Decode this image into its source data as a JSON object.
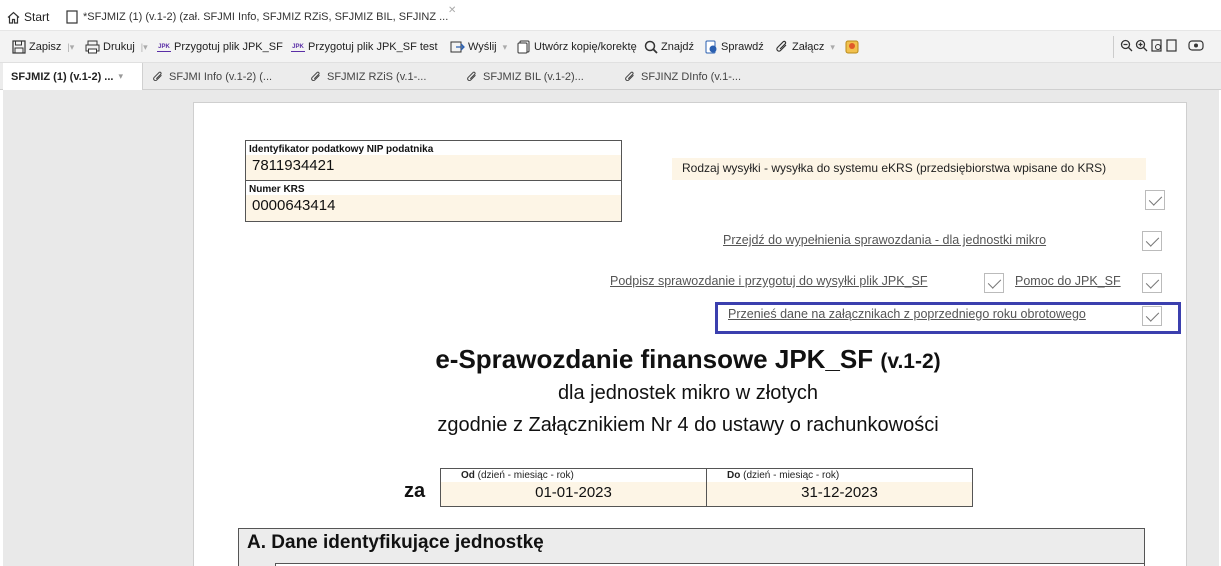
{
  "tabs": {
    "start": "Start",
    "document": "*SFJMIZ (1) (v.1-2) (zał. SFJMI Info, SFJMIZ RZiS, SFJMIZ BIL, SFJINZ ..."
  },
  "toolbar": {
    "save": "Zapisz",
    "print": "Drukuj",
    "prepare": "Przygotuj plik JPK_SF",
    "prepare_test": "Przygotuj plik JPK_SF test",
    "send": "Wyślij",
    "copy": "Utwórz kopię/korektę",
    "find": "Znajdź",
    "check": "Sprawdź",
    "attach": "Załącz"
  },
  "doc_tabs": [
    "SFJMIZ (1) (v.1-2) ...",
    "SFJMI Info (v.1-2) (...",
    "SFJMIZ RZiS (v.1-...",
    "SFJMIZ BIL (v.1-2)...",
    "SFJINZ DInfo (v.1-..."
  ],
  "form": {
    "nip_label": "Identyfikator podatkowy NIP podatnika",
    "nip_value": "7811934421",
    "krs_label": "Numer KRS",
    "krs_value": "0000643414",
    "send_type": "Rodzaj wysyłki - wysyłka do systemu eKRS (przedsiębiorstwa wpisane do KRS)",
    "link_fill": "Przejdź do wypełnienia sprawozdania - dla jednostki mikro",
    "link_sign": "Podpisz sprawozdanie i przygotuj do wysyłki plik JPK_SF",
    "link_help": "Pomoc do JPK_SF",
    "link_transfer": "Przenieś dane na załącznikach z poprzedniego roku obrotowego",
    "title_main": "e-Sprawozdanie finansowe JPK_SF",
    "title_version": "(v.1-2)",
    "subtitle1": "dla jednostek mikro w złotych",
    "subtitle2": "zgodnie z Załącznikiem Nr 4 do ustawy o rachunkowości",
    "za": "za",
    "from_label_bold": "Od",
    "from_label_rest": " (dzień - miesiąc - rok)",
    "from_value": "01-01-2023",
    "to_label_bold": "Do",
    "to_label_rest": " (dzień - miesiąc - rok)",
    "to_value": "31-12-2023",
    "section_a": "A. Dane identyfikujące jednostkę"
  },
  "colors": {
    "highlight": "#3b3fae",
    "field_bg": "#fdf5e6",
    "jpk_icon": "#5a2ea6"
  }
}
